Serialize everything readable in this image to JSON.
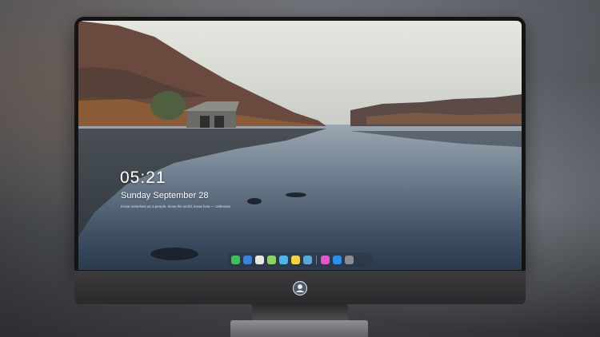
{
  "lockscreen": {
    "time": "05:21",
    "date": "Sunday September  28",
    "quote": "Know ourselves as a people, know the world, know how — Unknown"
  },
  "dock": {
    "items": [
      {
        "icon": "messages-icon",
        "color": "#3fbf5a"
      },
      {
        "icon": "finder-icon",
        "color": "#3b82d6"
      },
      {
        "icon": "clock-icon",
        "color": "#e8e8e8"
      },
      {
        "icon": "maps-icon",
        "color": "#8fd06b"
      },
      {
        "icon": "video-icon",
        "color": "#4cb7e8"
      },
      {
        "icon": "notes-icon",
        "color": "#f2d04a"
      },
      {
        "icon": "photos-icon",
        "color": "#59a7d9"
      },
      {
        "icon": "separator",
        "color": ""
      },
      {
        "icon": "itunes-icon",
        "color": "#e257c9"
      },
      {
        "icon": "app-store-icon",
        "color": "#2f8ee6"
      },
      {
        "icon": "camera-icon",
        "color": "#8a8d93"
      }
    ]
  }
}
